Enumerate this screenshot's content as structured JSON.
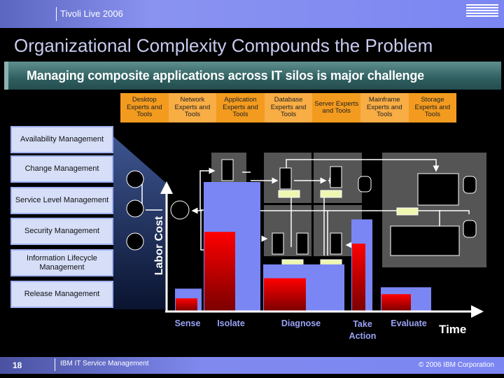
{
  "header": {
    "event": "Tivoli Live 2006",
    "logo": "IBM"
  },
  "title": "Organizational Complexity Compounds the Problem",
  "subtitle": "Managing composite applications across IT silos is major challenge",
  "silos": [
    "Desktop Experts and Tools",
    "Network Experts and Tools",
    "Application Experts and Tools",
    "Database Experts and Tools",
    "Server Experts and Tools",
    "Mainframe Experts and Tools",
    "Storage Experts and Tools"
  ],
  "processes": [
    "Availability Management",
    "Change Management",
    "Service Level Management",
    "Security Management",
    "Information Lifecycle Management",
    "Release Management"
  ],
  "colors": {
    "silo_orange": "#f39b1e",
    "bar_blue": "#7b86f5",
    "bar_red": "#e00000",
    "process_box": "#d6def8"
  },
  "chart_data": {
    "type": "bar",
    "ylabel": "Labor Cost",
    "xlabel": "Time",
    "categories": [
      "Sense",
      "Isolate",
      "Diagnose",
      "Take Action",
      "Evaluate"
    ],
    "series": [
      {
        "values": [
          33,
          187,
          68,
          133,
          35
        ]
      },
      {
        "values": [
          19,
          115,
          48,
          98,
          25
        ]
      }
    ],
    "ylim": [
      0,
      190
    ],
    "grid": false
  },
  "footer": {
    "page": "18",
    "section": "IBM IT Service Management",
    "copyright": "© 2006 IBM Corporation"
  }
}
